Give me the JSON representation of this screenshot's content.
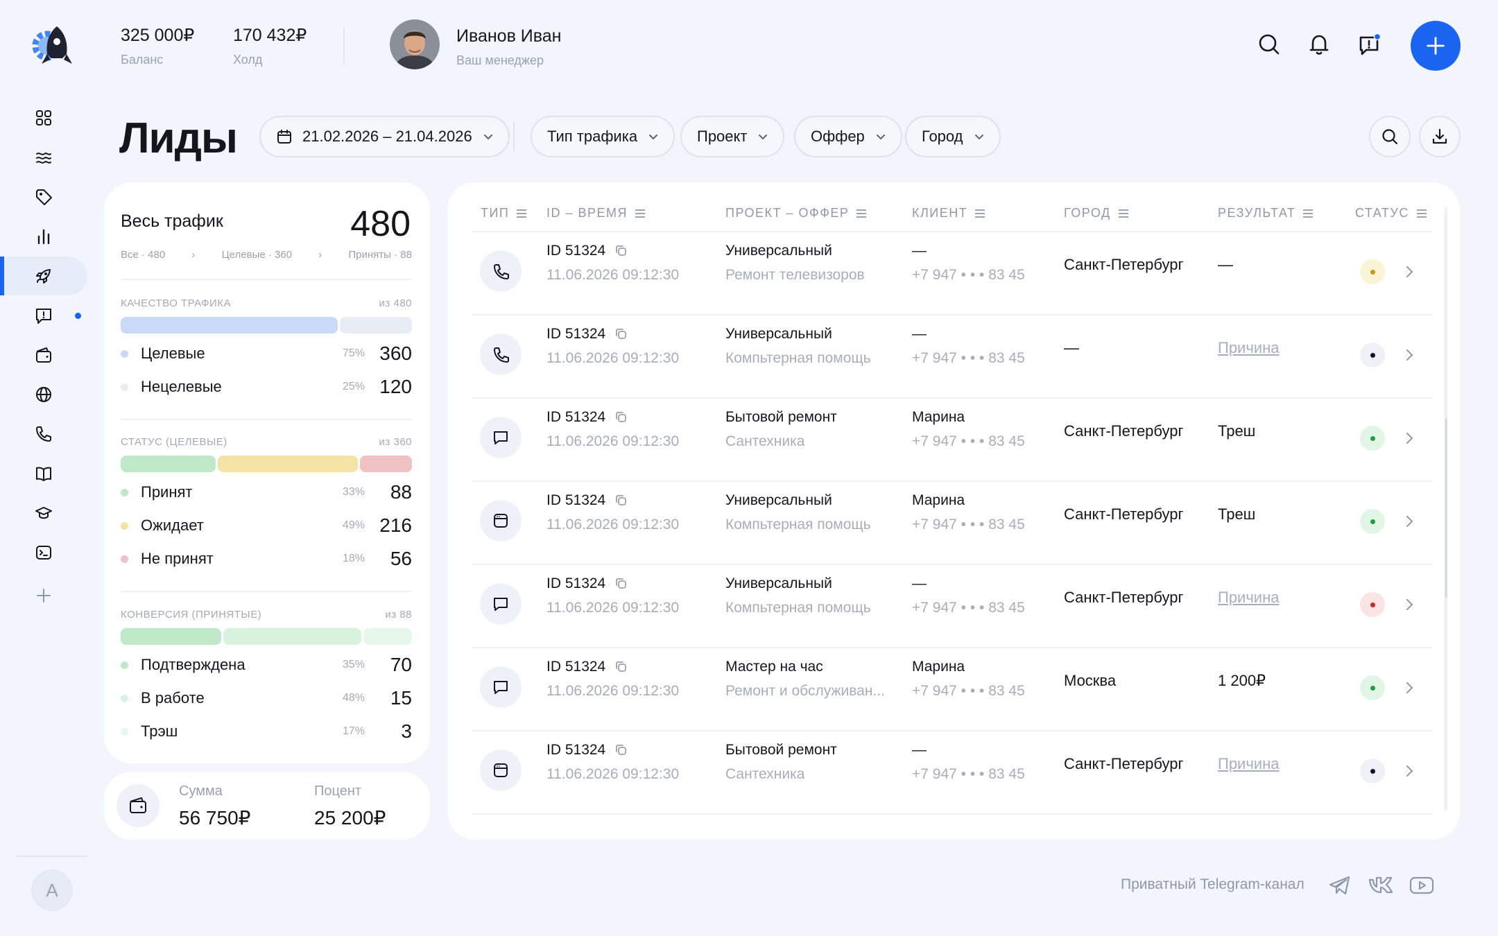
{
  "header": {
    "balance": {
      "value": "325 000₽",
      "label": "Баланс"
    },
    "hold": {
      "value": "170 432₽",
      "label": "Холд"
    },
    "manager": {
      "name": "Иванов Иван",
      "role": "Ваш менеджер"
    }
  },
  "sidebar": {
    "items": [
      {
        "icon": "grid-icon"
      },
      {
        "icon": "waves-icon"
      },
      {
        "icon": "tag-icon"
      },
      {
        "icon": "bar-chart-icon"
      },
      {
        "icon": "rocket-icon",
        "active": true
      },
      {
        "icon": "message-alert-icon",
        "dot": true
      },
      {
        "icon": "wallet-icon"
      },
      {
        "icon": "globe-icon"
      },
      {
        "icon": "phone-icon"
      },
      {
        "icon": "book-icon"
      },
      {
        "icon": "graduation-cap-icon"
      },
      {
        "icon": "terminal-icon"
      },
      {
        "icon": "plus-icon"
      }
    ],
    "user_initial": "A"
  },
  "page": {
    "title": "Лиды",
    "filters": {
      "date_range": "21.02.2026 – 21.04.2026",
      "traffic_type": "Тип трафика",
      "project": "Проект",
      "offer": "Оффер",
      "city": "Город"
    }
  },
  "stats": {
    "title": "Весь трафик",
    "total": "480",
    "crumbs": [
      "Все · 480",
      "Целевые · 360",
      "Приняты · 88"
    ],
    "quality": {
      "head": "КАЧЕСТВО ТРАФИКА",
      "of": "из 480",
      "rows": [
        {
          "name": "Целевые",
          "pct": "75%",
          "num": "360",
          "color": "#c9d9f8"
        },
        {
          "name": "Нецелевые",
          "pct": "25%",
          "num": "120",
          "color": "#e8ecf5"
        }
      ]
    },
    "status": {
      "head": "СТАТУС (ЦЕЛЕВЫЕ)",
      "of": "из 360",
      "rows": [
        {
          "name": "Принят",
          "pct": "33%",
          "num": "88",
          "color": "#bfe8c8"
        },
        {
          "name": "Ожидает",
          "pct": "49%",
          "num": "216",
          "color": "#f5e3a6"
        },
        {
          "name": "Не принят",
          "pct": "18%",
          "num": "56",
          "color": "#f0c2c3"
        }
      ]
    },
    "conversion": {
      "head": "КОНВЕРСИЯ (ПРИНЯТЫЕ)",
      "of": "из 88",
      "rows": [
        {
          "name": "Подтверждена",
          "pct": "35%",
          "num": "70",
          "color": "#bfe8c8"
        },
        {
          "name": "В работе",
          "pct": "48%",
          "num": "15",
          "color": "#d8f2dd"
        },
        {
          "name": "Трэш",
          "pct": "17%",
          "num": "3",
          "color": "#e8f7eb"
        }
      ]
    }
  },
  "summary": {
    "sum_label": "Сумма",
    "sum_value": "56 750₽",
    "percent_label": "Поцент",
    "percent_value": "25 200₽"
  },
  "table": {
    "columns": [
      "ТИП",
      "ID – ВРЕМЯ",
      "ПРОЕКТ – ОФФЕР",
      "КЛИЕНТ",
      "ГОРОД",
      "РЕЗУЛЬТАТ",
      "СТАТУС"
    ],
    "rows": [
      {
        "type": "phone-icon",
        "id": "ID 51324",
        "time": "11.06.2026  09:12:30",
        "project": "Универсальный",
        "offer": "Ремонт телевизоров",
        "client": "—",
        "phone": "+7 947 • • • 83 45",
        "city": "Санкт-Петербург",
        "result": "—",
        "result_link": false,
        "status": "waiting",
        "status_bg": "#fbf3d6",
        "status_dot": "#c99a12"
      },
      {
        "type": "phone-icon",
        "id": "ID 51324",
        "time": "11.06.2026  09:12:30",
        "project": "Универсальный",
        "offer": "Компьтерная помощь",
        "client": "—",
        "phone": "+7 947 • • • 83 45",
        "city": "—",
        "result": "Причина",
        "result_link": true,
        "status": "other",
        "status_bg": "#eef1f8",
        "status_dot": "#14161c"
      },
      {
        "type": "chat-icon",
        "id": "ID 51324",
        "time": "11.06.2026  09:12:30",
        "project": "Бытовой ремонт",
        "offer": "Сантехника",
        "client": "Марина",
        "phone": "+7 947 • • • 83 45",
        "city": "Санкт-Петербург",
        "result": "Треш",
        "result_link": false,
        "status": "accepted",
        "status_bg": "#e1f5e5",
        "status_dot": "#1f9d45"
      },
      {
        "type": "browser-icon",
        "id": "ID 51324",
        "time": "11.06.2026  09:12:30",
        "project": "Универсальный",
        "offer": "Компьтерная помощь",
        "client": "Марина",
        "phone": "+7 947 • • • 83 45",
        "city": "Санкт-Петербург",
        "result": "Треш",
        "result_link": false,
        "status": "accepted",
        "status_bg": "#e1f5e5",
        "status_dot": "#1f9d45"
      },
      {
        "type": "chat-icon",
        "id": "ID 51324",
        "time": "11.06.2026  09:12:30",
        "project": "Универсальный",
        "offer": "Компьтерная помощь",
        "client": "—",
        "phone": "+7 947 • • • 83 45",
        "city": "Санкт-Петербург",
        "result": "Причина",
        "result_link": true,
        "status": "rejected",
        "status_bg": "#fbe3e3",
        "status_dot": "#c42a2a"
      },
      {
        "type": "chat-icon",
        "id": "ID 51324",
        "time": "11.06.2026  09:12:30",
        "project": "Мастер на час",
        "offer": "Ремонт и обслуживан...",
        "client": "Марина",
        "phone": "+7 947 • • • 83 45",
        "city": "Москва",
        "result": "1 200₽",
        "result_link": false,
        "status": "accepted",
        "status_bg": "#e1f5e5",
        "status_dot": "#1f9d45"
      },
      {
        "type": "browser-icon",
        "id": "ID 51324",
        "time": "11.06.2026  09:12:30",
        "project": "Бытовой ремонт",
        "offer": "Сантехника",
        "client": "—",
        "phone": "+7 947 • • • 83 45",
        "city": "Санкт-Петербург",
        "result": "Причина",
        "result_link": true,
        "status": "other",
        "status_bg": "#eef1f8",
        "status_dot": "#14161c"
      }
    ]
  },
  "footer": {
    "telegram_text": "Приватный Telegram-канал",
    "links": [
      "telegram-icon",
      "vk-icon",
      "youtube-icon"
    ]
  }
}
